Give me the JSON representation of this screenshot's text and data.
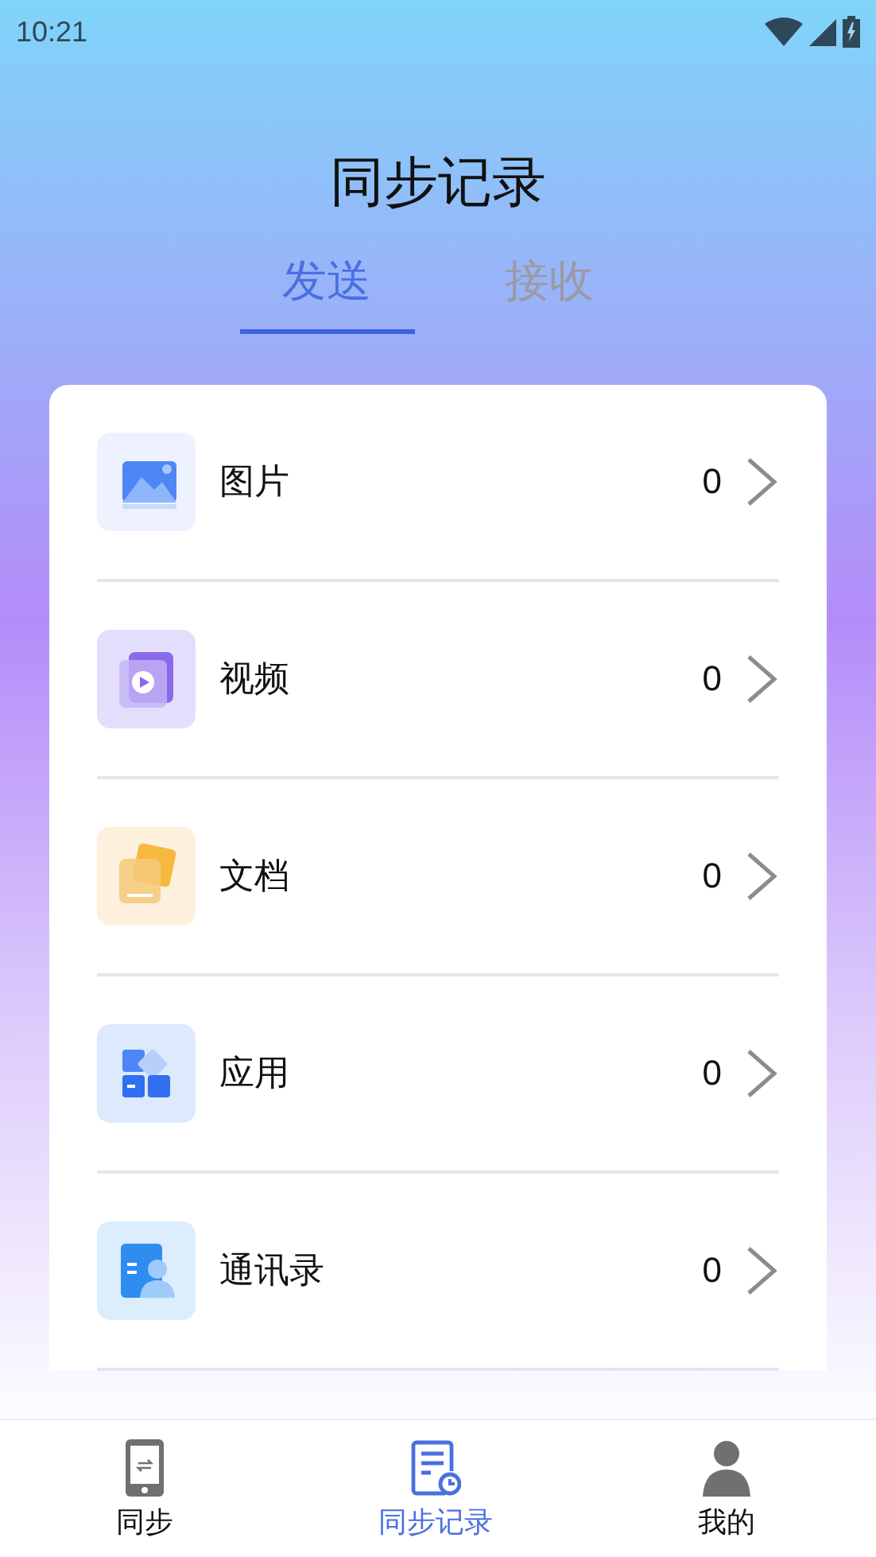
{
  "status_bar": {
    "time": "10:21"
  },
  "header": {
    "title": "同步记录"
  },
  "tabs": [
    {
      "label": "发送",
      "selected": true
    },
    {
      "label": "接收",
      "selected": false
    }
  ],
  "items": [
    {
      "kind": "picture",
      "label": "图片",
      "count": "0"
    },
    {
      "kind": "video",
      "label": "视频",
      "count": "0"
    },
    {
      "kind": "document",
      "label": "文档",
      "count": "0"
    },
    {
      "kind": "app",
      "label": "应用",
      "count": "0"
    },
    {
      "kind": "contacts",
      "label": "通讯录",
      "count": "0"
    }
  ],
  "bottom_nav": [
    {
      "kind": "sync",
      "label": "同步",
      "selected": false
    },
    {
      "kind": "records",
      "label": "同步记录",
      "selected": true
    },
    {
      "kind": "profile",
      "label": "我的",
      "selected": false
    }
  ]
}
